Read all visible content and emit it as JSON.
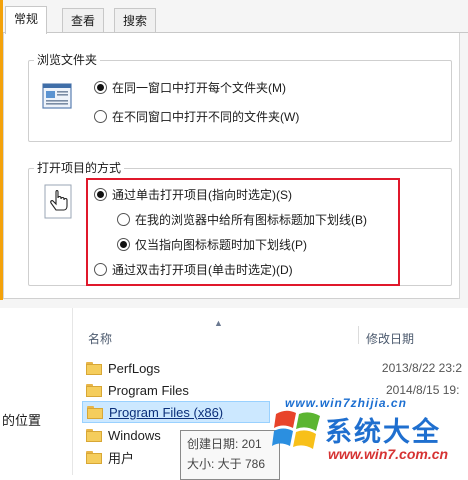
{
  "dialog": {
    "tabs": [
      {
        "label": "常规",
        "active": true
      },
      {
        "label": "查看",
        "active": false
      },
      {
        "label": "搜索",
        "active": false
      }
    ],
    "browse_group": {
      "title": "浏览文件夹",
      "options": [
        {
          "label": "在同一窗口中打开每个文件夹(M)",
          "checked": true
        },
        {
          "label": "在不同窗口中打开不同的文件夹(W)",
          "checked": false
        }
      ]
    },
    "click_group": {
      "title": "打开项目的方式",
      "single_click": {
        "label": "通过单击打开项目(指向时选定)(S)",
        "checked": true
      },
      "underline_all": {
        "label": "在我的浏览器中给所有图标标题加下划线(B)",
        "checked": false
      },
      "underline_point": {
        "label": "仅当指向图标标题时加下划线(P)",
        "checked": true
      },
      "double_click": {
        "label": "通过双击打开项目(单击时选定)(D)",
        "checked": false
      }
    },
    "highlight_color": "#e0182b"
  },
  "explorer": {
    "left_pane_label": "的位置",
    "columns": {
      "name": "名称",
      "date": "修改日期"
    },
    "rows": [
      {
        "name": "PerfLogs",
        "date": "2013/8/22 23:2",
        "selected": false
      },
      {
        "name": "Program Files",
        "date": "2014/8/15 19:",
        "selected": false
      },
      {
        "name": "Program Files (x86)",
        "date": "",
        "selected": true
      },
      {
        "name": "Windows",
        "date": "",
        "selected": false
      },
      {
        "name": "用户",
        "date": "",
        "selected": false
      }
    ],
    "tooltip": {
      "created_label": "创建日期: 201",
      "size_label": "大小: 大于 786"
    }
  },
  "watermark": {
    "url": "www.win7zhijia.cn",
    "title": "系统大全",
    "domain": "www.win7.com.cn"
  }
}
